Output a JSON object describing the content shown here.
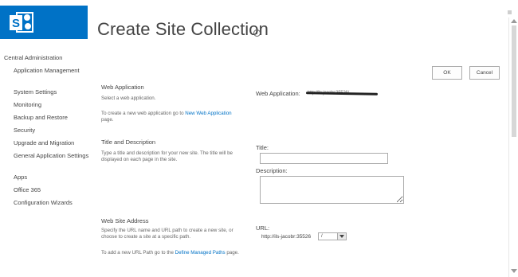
{
  "header": {
    "title": "Create Site Collection",
    "info_glyph": "i",
    "logo_icon": "sharepoint-logo-icon"
  },
  "nav": {
    "heading": "Central Administration",
    "items": [
      {
        "label": "Application Management"
      },
      {
        "label": "System Settings"
      },
      {
        "label": "Monitoring"
      },
      {
        "label": "Backup and Restore"
      },
      {
        "label": "Security"
      },
      {
        "label": "Upgrade and Migration"
      },
      {
        "label": "General Application Settings"
      },
      {
        "label": "Apps"
      },
      {
        "label": "Office 365"
      },
      {
        "label": "Configuration Wizards"
      }
    ]
  },
  "buttons": {
    "ok": "OK",
    "cancel": "Cancel"
  },
  "sections": {
    "web_app": {
      "title": "Web Application",
      "desc": "Select a web application.",
      "link_prefix": "To create a new web application go to ",
      "link_text": "New Web Application",
      "link_suffix": " page.",
      "field_label": "Web Application:",
      "field_value": "http://ils-jacobr:35526/"
    },
    "title_desc": {
      "title": "Title and Description",
      "desc": "Type a title and description for your new site. The title will be displayed on each page in the site.",
      "title_label": "Title:",
      "title_value": "",
      "description_label": "Description:",
      "description_value": ""
    },
    "address": {
      "title": "Web Site Address",
      "desc": "Specify the URL name and URL path to create a new site, or choose to create a site at a specific path.",
      "link_prefix": "To add a new URL Path go to the ",
      "link_text": "Define Managed Paths",
      "link_suffix": " page.",
      "url_label": "URL:",
      "url_prefix": "http://ils-jacobr:35526",
      "url_path_selected": "/"
    }
  },
  "colors": {
    "accent": "#0072c6",
    "text": "#444444",
    "link": "#0072c6"
  }
}
